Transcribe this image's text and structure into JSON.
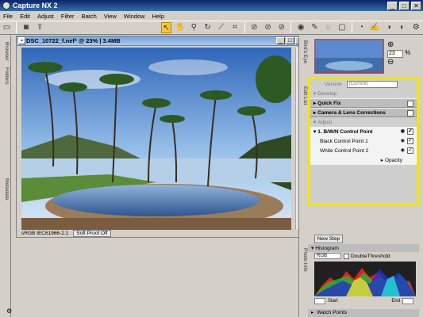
{
  "window": {
    "title": "Capture NX 2"
  },
  "menu": [
    "File",
    "Edit",
    "Adjust",
    "Filter",
    "Batch",
    "View",
    "Window",
    "Help"
  ],
  "side_tabs": {
    "browser": "Browser",
    "folders": "Folders",
    "metadata": "Metadata",
    "birds_eye": "Bird's Eye",
    "edit_list": "Edit List",
    "photo_info": "Photo Info"
  },
  "image_window": {
    "title": "DSC_10722_f.nef* @ 23% | 3.4MB",
    "color_profile": "sRGB IEC61966-2.1",
    "soft_proof": "Soft Proof Off"
  },
  "zoom": {
    "value": "23",
    "unit": "%"
  },
  "edit_list": {
    "versions_label": "Version",
    "versions_value": "(Current)",
    "develop_label": "Develop",
    "quick_fix_label": "Quick Fix",
    "camera_lens_label": "Camera & Lens Corrections",
    "adjust_label": "Adjust",
    "step_label": "1. B/W/N Control Point",
    "black_cp_label": "Black Control Point 1",
    "white_cp_label": "White Control Point 2",
    "opacity_label": "Opacity"
  },
  "new_step_label": "New Step",
  "histogram": {
    "title": "Histogram",
    "channel": "RGB",
    "double_threshold": "DoubleThreshold",
    "start_label": "Start",
    "end_label": "End"
  },
  "watch_points_label": "Watch Points",
  "colors": {
    "highlight": "#f2e500",
    "titlebar": "#0a246a"
  }
}
